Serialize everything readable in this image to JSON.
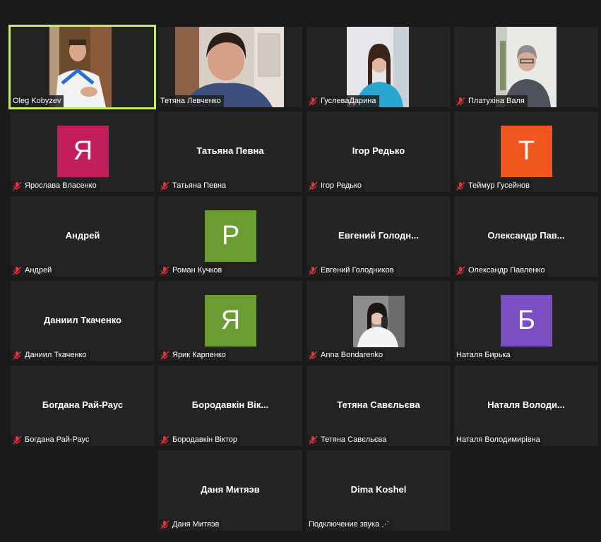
{
  "participants": [
    {
      "tile_text": "",
      "label": "Oleg Kobyzev",
      "muted": false,
      "kind": "video",
      "active": true
    },
    {
      "tile_text": "",
      "label": "Тетяна Левченко",
      "muted": false,
      "kind": "video"
    },
    {
      "tile_text": "",
      "label": "ГуслеваДарина",
      "muted": true,
      "kind": "video"
    },
    {
      "tile_text": "",
      "label": "Платухіна Валя",
      "muted": true,
      "kind": "video"
    },
    {
      "tile_text": "Я",
      "label": "Ярослава Власенко",
      "muted": true,
      "kind": "avatar",
      "avatar_color": "#c21e5a"
    },
    {
      "tile_text": "Татьяна Певна",
      "label": "Татьяна Певна",
      "muted": true,
      "kind": "name"
    },
    {
      "tile_text": "Ігор Редько",
      "label": "Ігор Редько",
      "muted": true,
      "kind": "name"
    },
    {
      "tile_text": "T",
      "label": "Теймур Гусейнов",
      "muted": true,
      "kind": "avatar",
      "avatar_color": "#f0561d"
    },
    {
      "tile_text": "Андрей",
      "label": "Андрей",
      "muted": true,
      "kind": "name"
    },
    {
      "tile_text": "P",
      "label": "Роман Кучков",
      "muted": true,
      "kind": "avatar",
      "avatar_color": "#6a9d33"
    },
    {
      "tile_text": "Евгений  Голодн...",
      "label": "Евгений Голодников",
      "muted": true,
      "kind": "name"
    },
    {
      "tile_text": "Олександр  Пав...",
      "label": "Олександр Павленко",
      "muted": true,
      "kind": "name"
    },
    {
      "tile_text": "Даниил Ткаченко",
      "label": "Даниил Ткаченко",
      "muted": true,
      "kind": "name"
    },
    {
      "tile_text": "Я",
      "label": "Ярик Карпенко",
      "muted": true,
      "kind": "avatar",
      "avatar_color": "#6a9d33"
    },
    {
      "tile_text": "",
      "label": "Anna Bondarenko",
      "muted": true,
      "kind": "photo"
    },
    {
      "tile_text": "Б",
      "label": "Наталя Бирька",
      "muted": false,
      "kind": "avatar",
      "avatar_color": "#7b4fc2"
    },
    {
      "tile_text": "Богдана Рай-Раус",
      "label": "Богдана Рай-Раус",
      "muted": true,
      "kind": "name"
    },
    {
      "tile_text": "Бородавкін Вік...",
      "label": "Бородавкін Віктор",
      "muted": true,
      "kind": "name"
    },
    {
      "tile_text": "Тетяна Савєльєва",
      "label": "Тетяна Савєльєва",
      "muted": true,
      "kind": "name"
    },
    {
      "tile_text": "Наталя  Володи...",
      "label": "Наталя Володимирівна",
      "muted": false,
      "kind": "name"
    },
    {
      "tile_text": "Даня Митяэв",
      "label": "Даня Митяэв",
      "muted": true,
      "kind": "name"
    },
    {
      "tile_text": "Dima Koshel",
      "label": "Подключение звука ⋰",
      "muted": false,
      "kind": "name"
    }
  ],
  "colors": {
    "active_border": "#c8e86a",
    "muted_icon": "#e0343e",
    "tile_bg": "#242424",
    "page_bg": "#1a1a1a"
  }
}
